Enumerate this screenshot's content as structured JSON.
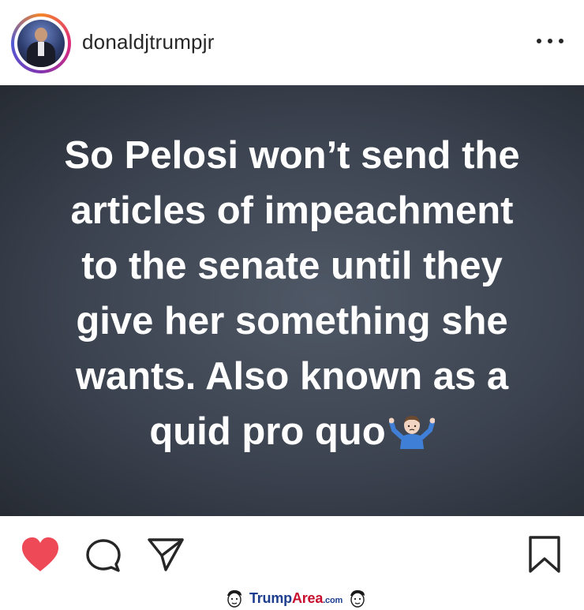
{
  "header": {
    "username": "donaldjtrumpjr",
    "more_icon": "more-horizontal-icon"
  },
  "post": {
    "lines": [
      "So Pelosi won’t send the",
      "articles of impeachment",
      "to the senate until they",
      "give her something she",
      "wants.  Also known as a",
      "quid pro quo"
    ],
    "emoji": "person-shrugging-emoji",
    "background_color": "#3c4350",
    "text_color": "#ffffff"
  },
  "actions": {
    "like_icon": "heart-icon",
    "comment_icon": "comment-icon",
    "share_icon": "send-icon",
    "save_icon": "bookmark-icon",
    "like_color": "#ed4956"
  },
  "watermark": {
    "part1": "Trump",
    "part2": "Area",
    "part3": ".com"
  }
}
